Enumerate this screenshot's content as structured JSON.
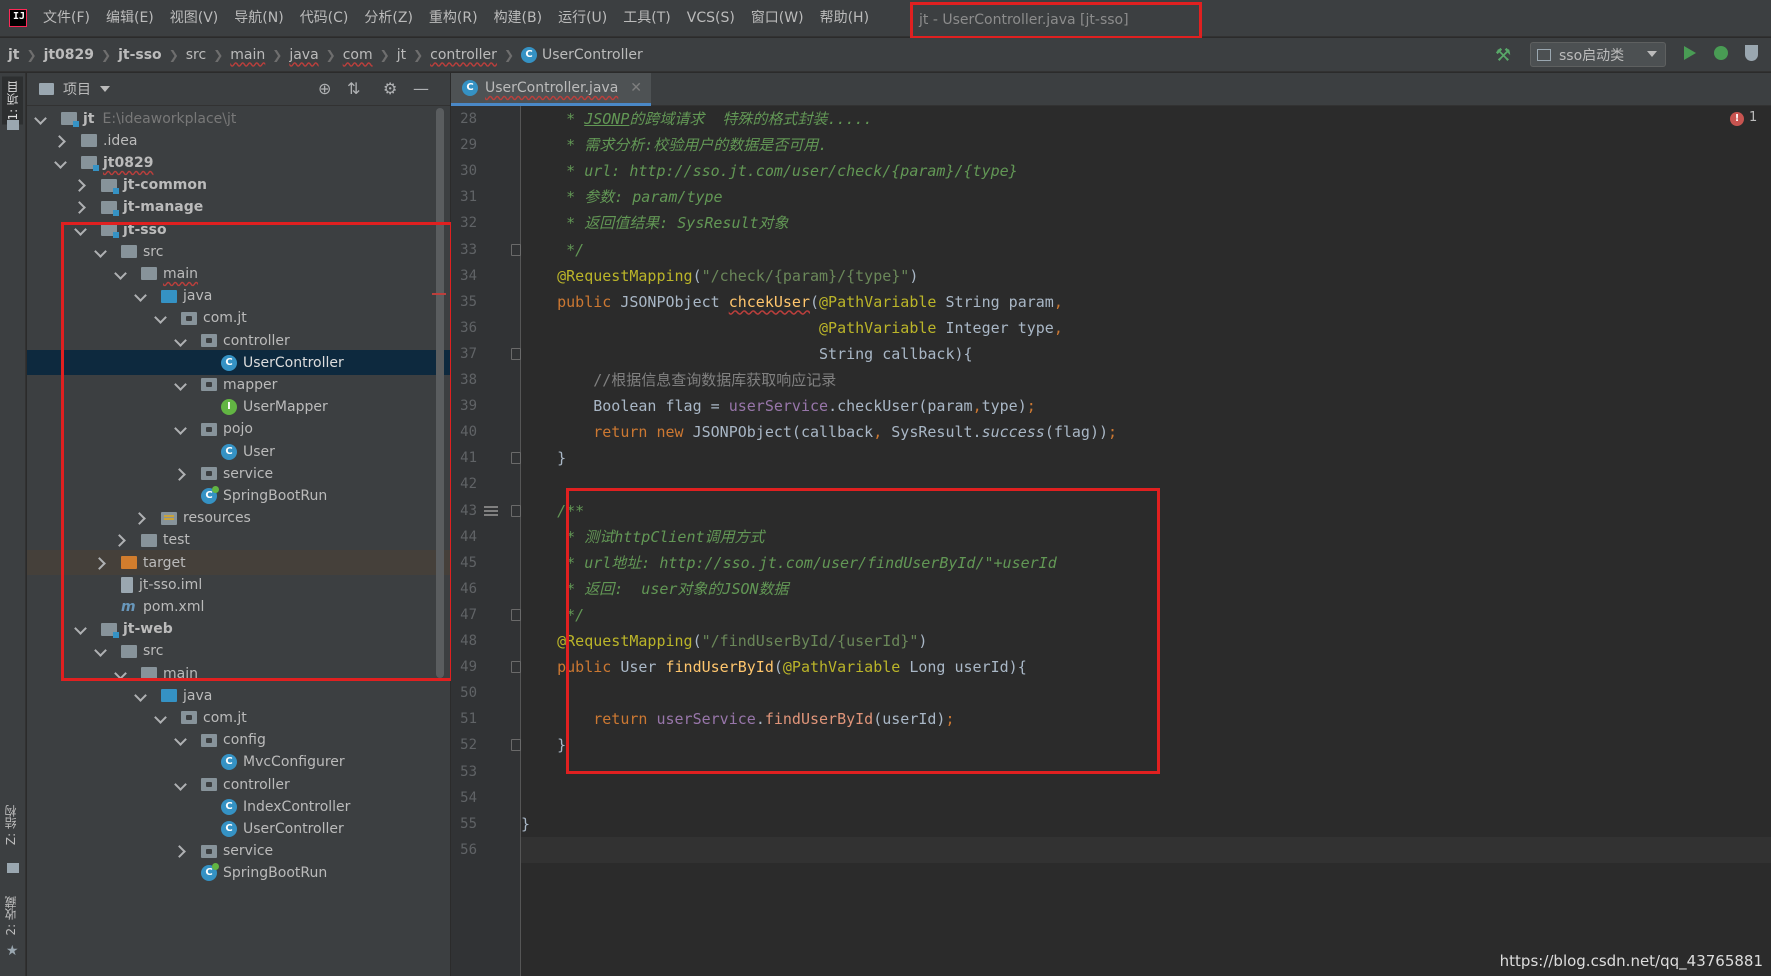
{
  "menubar": {
    "logo_text": "IJ",
    "items": [
      "文件(F)",
      "编辑(E)",
      "视图(V)",
      "导航(N)",
      "代码(C)",
      "分析(Z)",
      "重构(R)",
      "构建(B)",
      "运行(U)",
      "工具(T)",
      "VCS(S)",
      "窗口(W)",
      "帮助(H)"
    ],
    "window_title": "jt - UserController.java [jt-sso]"
  },
  "breadcrumb": [
    "jt",
    "jt0829",
    "jt-sso",
    "src",
    "main",
    "java",
    "com",
    "jt",
    "controller",
    "UserController"
  ],
  "toolbar": {
    "run_config": "sso启动类"
  },
  "toolstrip": {
    "tab_project": "1: 项目",
    "tab_structure": "Z: 结构",
    "tab_favorites": "2: 收藏"
  },
  "project": {
    "title": "项目",
    "tree": [
      {
        "label": "jt",
        "path": "E:\\ideaworkplace\\jt",
        "level": 0,
        "state": "open",
        "icon": "module",
        "bold": true
      },
      {
        "label": ".idea",
        "level": 1,
        "state": "closed",
        "icon": "folder"
      },
      {
        "label": "jt0829",
        "level": 1,
        "state": "open",
        "icon": "module",
        "bold": true,
        "squiggle": true
      },
      {
        "label": "jt-common",
        "level": 2,
        "state": "closed",
        "icon": "module",
        "bold": true
      },
      {
        "label": "jt-manage",
        "level": 2,
        "state": "closed",
        "icon": "module",
        "bold": true
      },
      {
        "label": "jt-sso",
        "level": 2,
        "state": "open",
        "icon": "module",
        "bold": true
      },
      {
        "label": "src",
        "level": 3,
        "state": "open",
        "icon": "folder"
      },
      {
        "label": "main",
        "level": 4,
        "state": "open",
        "icon": "folder",
        "squiggle": true
      },
      {
        "label": "java",
        "level": 5,
        "state": "open",
        "icon": "src"
      },
      {
        "label": "com.jt",
        "level": 6,
        "state": "open",
        "icon": "package"
      },
      {
        "label": "controller",
        "level": 7,
        "state": "open",
        "icon": "package"
      },
      {
        "label": "UserController",
        "level": 8,
        "state": "none",
        "icon": "classc",
        "selected": true
      },
      {
        "label": "mapper",
        "level": 7,
        "state": "open",
        "icon": "package"
      },
      {
        "label": "UserMapper",
        "level": 8,
        "state": "none",
        "icon": "classi"
      },
      {
        "label": "pojo",
        "level": 7,
        "state": "open",
        "icon": "package"
      },
      {
        "label": "User",
        "level": 8,
        "state": "none",
        "icon": "classc"
      },
      {
        "label": "service",
        "level": 7,
        "state": "closed",
        "icon": "package"
      },
      {
        "label": "SpringBootRun",
        "level": 7,
        "state": "none",
        "icon": "springc"
      },
      {
        "label": "resources",
        "level": 5,
        "state": "closed",
        "icon": "resources"
      },
      {
        "label": "test",
        "level": 4,
        "state": "closed",
        "icon": "folder"
      },
      {
        "label": "target",
        "level": 3,
        "state": "closed",
        "icon": "target",
        "excluded": true
      },
      {
        "label": "jt-sso.iml",
        "level": 3,
        "state": "none",
        "icon": "iml"
      },
      {
        "label": "pom.xml",
        "level": 3,
        "state": "none",
        "icon": "mvn"
      },
      {
        "label": "jt-web",
        "level": 2,
        "state": "open",
        "icon": "module",
        "bold": true
      },
      {
        "label": "src",
        "level": 3,
        "state": "open",
        "icon": "folder"
      },
      {
        "label": "main",
        "level": 4,
        "state": "open",
        "icon": "folder"
      },
      {
        "label": "java",
        "level": 5,
        "state": "open",
        "icon": "src"
      },
      {
        "label": "com.jt",
        "level": 6,
        "state": "open",
        "icon": "package"
      },
      {
        "label": "config",
        "level": 7,
        "state": "open",
        "icon": "package"
      },
      {
        "label": "MvcConfigurer",
        "level": 8,
        "state": "none",
        "icon": "classc"
      },
      {
        "label": "controller",
        "level": 7,
        "state": "open",
        "icon": "package"
      },
      {
        "label": "IndexController",
        "level": 8,
        "state": "none",
        "icon": "classc"
      },
      {
        "label": "UserController",
        "level": 8,
        "state": "none",
        "icon": "classc"
      },
      {
        "label": "service",
        "level": 7,
        "state": "closed",
        "icon": "package"
      },
      {
        "label": "SpringBootRun",
        "level": 7,
        "state": "none",
        "icon": "springc"
      }
    ]
  },
  "editor": {
    "tab_label": "UserController.java",
    "error_count": "1",
    "current_line": 56,
    "lines": [
      {
        "n": 28,
        "tokens": [
          [
            "doc",
            "     * "
          ],
          [
            "docu",
            "JSONP"
          ],
          [
            "doc",
            "的跨域请求  特殊的格式封装....."
          ]
        ]
      },
      {
        "n": 29,
        "tokens": [
          [
            "doc",
            "     * 需求分析:校验用户的数据是否可用."
          ]
        ]
      },
      {
        "n": 30,
        "tokens": [
          [
            "doc",
            "     * url: http://sso.jt.com/user/check/{param}/{type}"
          ]
        ]
      },
      {
        "n": 31,
        "tokens": [
          [
            "doc",
            "     * 参数: param/type"
          ]
        ]
      },
      {
        "n": 32,
        "tokens": [
          [
            "doc",
            "     * 返回值结果: SysResult对象"
          ]
        ]
      },
      {
        "n": 33,
        "tokens": [
          [
            "doc",
            "     */"
          ]
        ]
      },
      {
        "n": 34,
        "tokens": [
          [
            "ann",
            "    @RequestMapping"
          ],
          [
            "plain",
            "("
          ],
          [
            "str",
            "\"/check/{param}/{type}\""
          ],
          [
            "plain",
            ")"
          ]
        ]
      },
      {
        "n": 35,
        "tokens": [
          [
            "kw",
            "    public "
          ],
          [
            "plain",
            "JSONPObject "
          ],
          [
            "methodu",
            "chcekUser"
          ],
          [
            "plain",
            "("
          ],
          [
            "ann",
            "@PathVariable "
          ],
          [
            "plain",
            "String param"
          ],
          [
            "kw",
            ","
          ]
        ]
      },
      {
        "n": 36,
        "tokens": [
          [
            "plain",
            "                                 "
          ],
          [
            "ann",
            "@PathVariable "
          ],
          [
            "plain",
            "Integer type"
          ],
          [
            "kw",
            ","
          ]
        ]
      },
      {
        "n": 37,
        "tokens": [
          [
            "plain",
            "                                 String callback){"
          ]
        ]
      },
      {
        "n": 38,
        "tokens": [
          [
            "cmt",
            "        //根据信息查询数据库获取响应记录"
          ]
        ]
      },
      {
        "n": 39,
        "tokens": [
          [
            "plain",
            "        Boolean flag = "
          ],
          [
            "field",
            "userService"
          ],
          [
            "plain",
            ".checkUser(param"
          ],
          [
            "kw",
            ","
          ],
          [
            "plain",
            "type)"
          ],
          [
            "kw",
            ";"
          ]
        ]
      },
      {
        "n": 40,
        "tokens": [
          [
            "kw",
            "        return new "
          ],
          [
            "plain",
            "JSONPObject(callback"
          ],
          [
            "kw",
            ", "
          ],
          [
            "plain",
            "SysResult."
          ],
          [
            "static",
            "success"
          ],
          [
            "plain",
            "(flag))"
          ],
          [
            "kw",
            ";"
          ]
        ]
      },
      {
        "n": 41,
        "tokens": [
          [
            "plain",
            "    }"
          ]
        ]
      },
      {
        "n": 42,
        "tokens": []
      },
      {
        "n": 43,
        "tokens": [
          [
            "doc",
            "    /**"
          ]
        ]
      },
      {
        "n": 44,
        "tokens": [
          [
            "doc",
            "     * 测试httpClient调用方式"
          ]
        ]
      },
      {
        "n": 45,
        "tokens": [
          [
            "doc",
            "     * url地址: http://sso.jt.com/user/findUserById/\"+userId"
          ]
        ]
      },
      {
        "n": 46,
        "tokens": [
          [
            "doc",
            "     * 返回:  user对象的JSON数据"
          ]
        ]
      },
      {
        "n": 47,
        "tokens": [
          [
            "doc",
            "     */"
          ]
        ]
      },
      {
        "n": 48,
        "tokens": [
          [
            "ann",
            "    @RequestMapping"
          ],
          [
            "plain",
            "("
          ],
          [
            "str",
            "\"/findUserById/{userId}\""
          ],
          [
            "plain",
            ")"
          ]
        ]
      },
      {
        "n": 49,
        "tokens": [
          [
            "kw",
            "    public "
          ],
          [
            "plain",
            "User "
          ],
          [
            "call",
            "findUserById"
          ],
          [
            "plain",
            "("
          ],
          [
            "ann",
            "@PathVariable "
          ],
          [
            "plain",
            "Long userId){"
          ]
        ]
      },
      {
        "n": 50,
        "tokens": []
      },
      {
        "n": 51,
        "tokens": [
          [
            "kw",
            "        return "
          ],
          [
            "field",
            "userService"
          ],
          [
            "plain",
            "."
          ],
          [
            "err",
            "findUserById"
          ],
          [
            "plain",
            "(userId)"
          ],
          [
            "kw",
            ";"
          ]
        ]
      },
      {
        "n": 52,
        "tokens": [
          [
            "plain",
            "    }"
          ]
        ]
      },
      {
        "n": 53,
        "tokens": []
      },
      {
        "n": 54,
        "tokens": []
      },
      {
        "n": 55,
        "tokens": [
          [
            "plain",
            "}"
          ]
        ]
      },
      {
        "n": 56,
        "tokens": []
      }
    ]
  },
  "watermark": "https://blog.csdn.net/qq_43765881",
  "colors": {
    "highlight_box": "#e02020",
    "keyword": "#cc7832",
    "annotation": "#bbb529",
    "string": "#6a8759",
    "doc_comment": "#629755",
    "field": "#9876aa",
    "method": "#ffc66d"
  }
}
